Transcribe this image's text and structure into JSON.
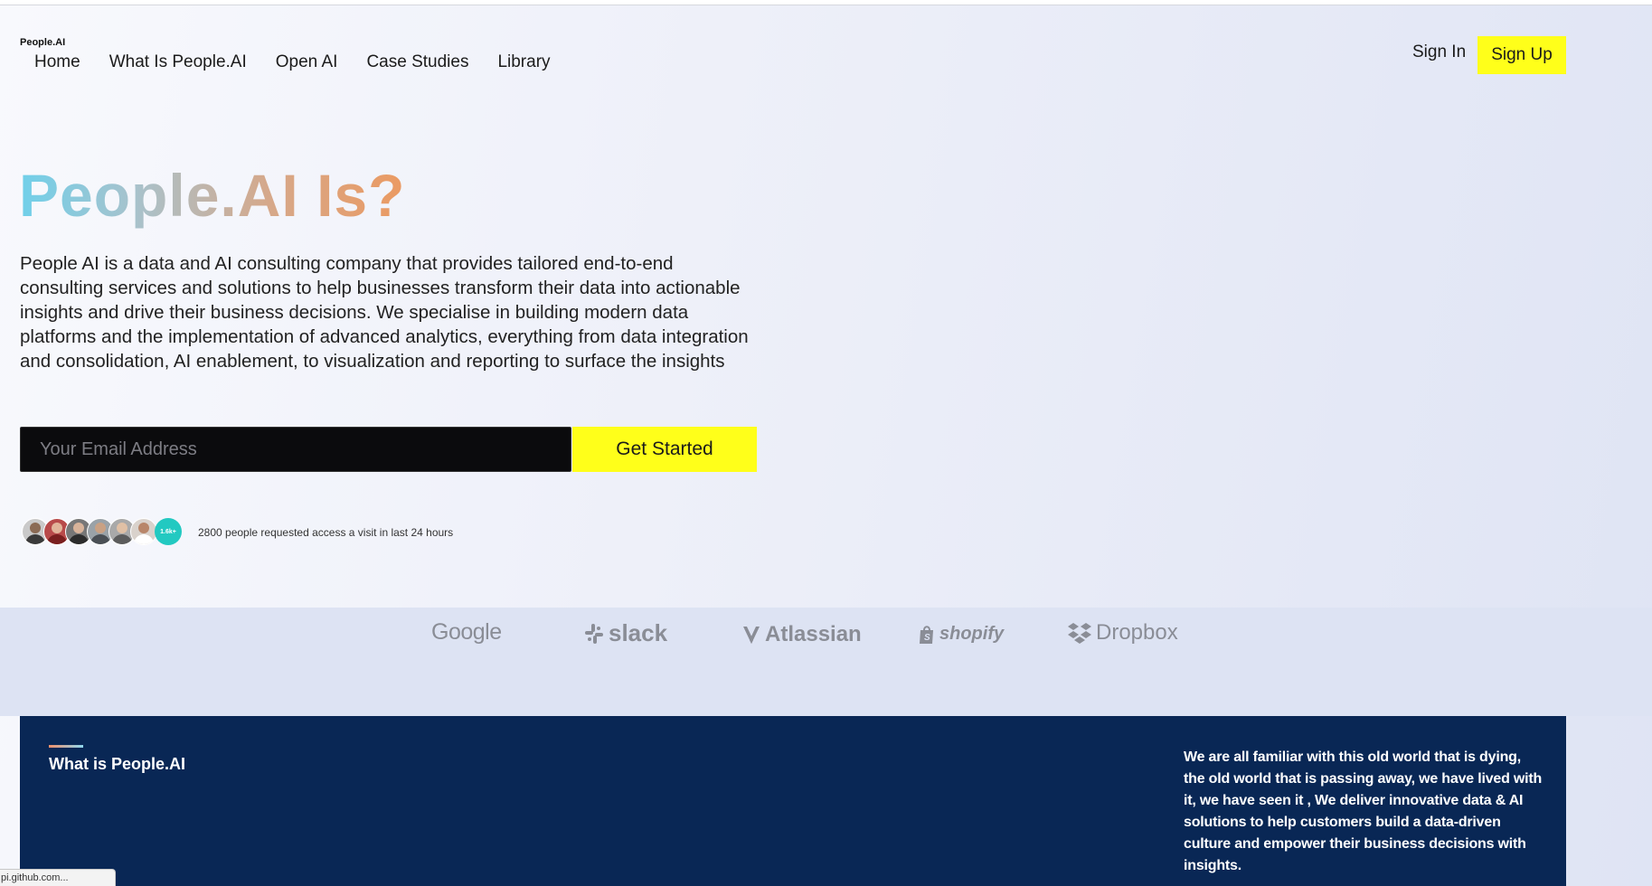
{
  "brand": "People.AI",
  "nav": {
    "items": [
      "Home",
      "What Is People.AI",
      "Open AI",
      "Case Studies",
      "Library"
    ]
  },
  "auth": {
    "sign_in": "Sign In",
    "sign_up": "Sign Up"
  },
  "hero": {
    "title": "People.AI Is?",
    "description": "People AI is a data and AI consulting company that provides tailored end-to-end consulting services and solutions to help businesses transform their data into actionable insights and drive their business decisions. We specialise in building modern data platforms and the implementation of advanced analytics, everything from data integration and consolidation, AI enablement, to visualization and reporting to surface the insights",
    "email_placeholder": "Your Email Address",
    "cta": "Get Started",
    "avatar_count": "1.6k+",
    "access_text": "2800 people requested access a visit in last 24 hours"
  },
  "logos": [
    "Google",
    "slack",
    "Atlassian",
    "shopify",
    "Dropbox"
  ],
  "info": {
    "title": "What is People.AI",
    "text": "We are all familiar with this old world that is dying, the old world that is passing away, we have lived with it, we have seen it , We deliver innovative data & AI solutions to help customers build a data-driven culture and empower their business decisions with insights."
  },
  "status_bar": {
    "url": "pi.github.com..."
  },
  "colors": {
    "accent_yellow": "#ffff1a",
    "panel_navy": "#092755",
    "avatar_teal": "#22c9c1"
  }
}
